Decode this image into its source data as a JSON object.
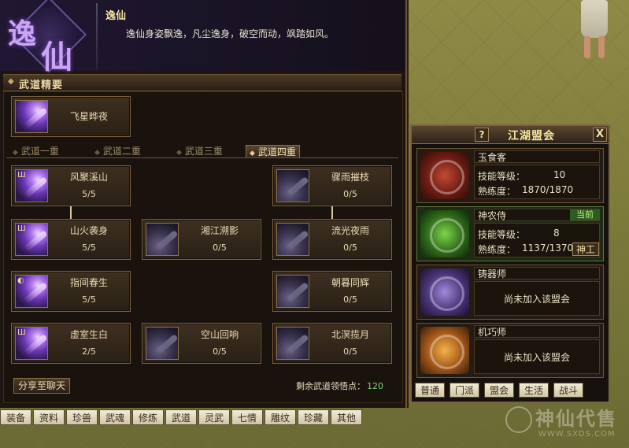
{
  "watermark": {
    "title": "神仙代售",
    "url": "WWW.SXDS.COM"
  },
  "header": {
    "emblem_chars": [
      "逸",
      "仙"
    ],
    "name": "逸仙",
    "description": "逸仙身姿飘逸，凡尘逸身，破空而动，飒踏如风。"
  },
  "section": {
    "title": "武道精要"
  },
  "featured_skill": {
    "name": "飞星晔夜",
    "icon": "purple-slash-icon"
  },
  "tabs": [
    "武道一重",
    "武道二重",
    "武道三重",
    "武道四重"
  ],
  "active_tab": "武道四重",
  "skills": [
    {
      "name": "风聚溪山",
      "level": "5/5",
      "learned": true
    },
    {
      "name": "骤雨摧枝",
      "level": "0/5",
      "learned": false
    },
    {
      "name": "山火袭身",
      "level": "5/5",
      "learned": true
    },
    {
      "name": "湘江溯影",
      "level": "0/5",
      "learned": false
    },
    {
      "name": "流光夜雨",
      "level": "0/5",
      "learned": false
    },
    {
      "name": "指间春生",
      "level": "5/5",
      "learned": true
    },
    {
      "name": "朝暮同辉",
      "level": "0/5",
      "learned": false
    },
    {
      "name": "虚室生白",
      "level": "2/5",
      "learned": true
    },
    {
      "name": "空山回响",
      "level": "0/5",
      "learned": false
    },
    {
      "name": "北溟揽月",
      "level": "0/5",
      "learned": false
    }
  ],
  "share_button": "分享至聊天",
  "points": {
    "label": "剩余武道领悟点：",
    "value": "120"
  },
  "bottom_tabs": [
    "装备",
    "资料",
    "珍兽",
    "武魂",
    "修炼",
    "武道",
    "灵武",
    "七情",
    "雕纹",
    "珍藏",
    "其他"
  ],
  "alliance": {
    "help": "?",
    "title": "江湖盟会",
    "close": "X",
    "guilds": [
      {
        "name": "玉食客",
        "level_label": "技能等级：",
        "level": "10",
        "prof_label": "熟练度：",
        "proficiency": "1870/1870",
        "emblem": "red"
      },
      {
        "name": "神农侍",
        "badge": "当前",
        "level_label": "技能等级：",
        "level": "8",
        "prof_label": "熟练度：",
        "proficiency": "1137/1370",
        "action": "神工",
        "emblem": "green"
      },
      {
        "name": "铸器师",
        "status": "尚未加入该盟会",
        "emblem": "purple"
      },
      {
        "name": "机巧师",
        "status": "尚未加入该盟会",
        "emblem": "orange"
      }
    ],
    "tabs": [
      "普通",
      "门派",
      "盟会",
      "生活",
      "战斗"
    ]
  },
  "colors": {
    "accent_gold": "#f4e5a1",
    "points_green": "#7ad26a",
    "current_badge": "#b6f07a"
  }
}
